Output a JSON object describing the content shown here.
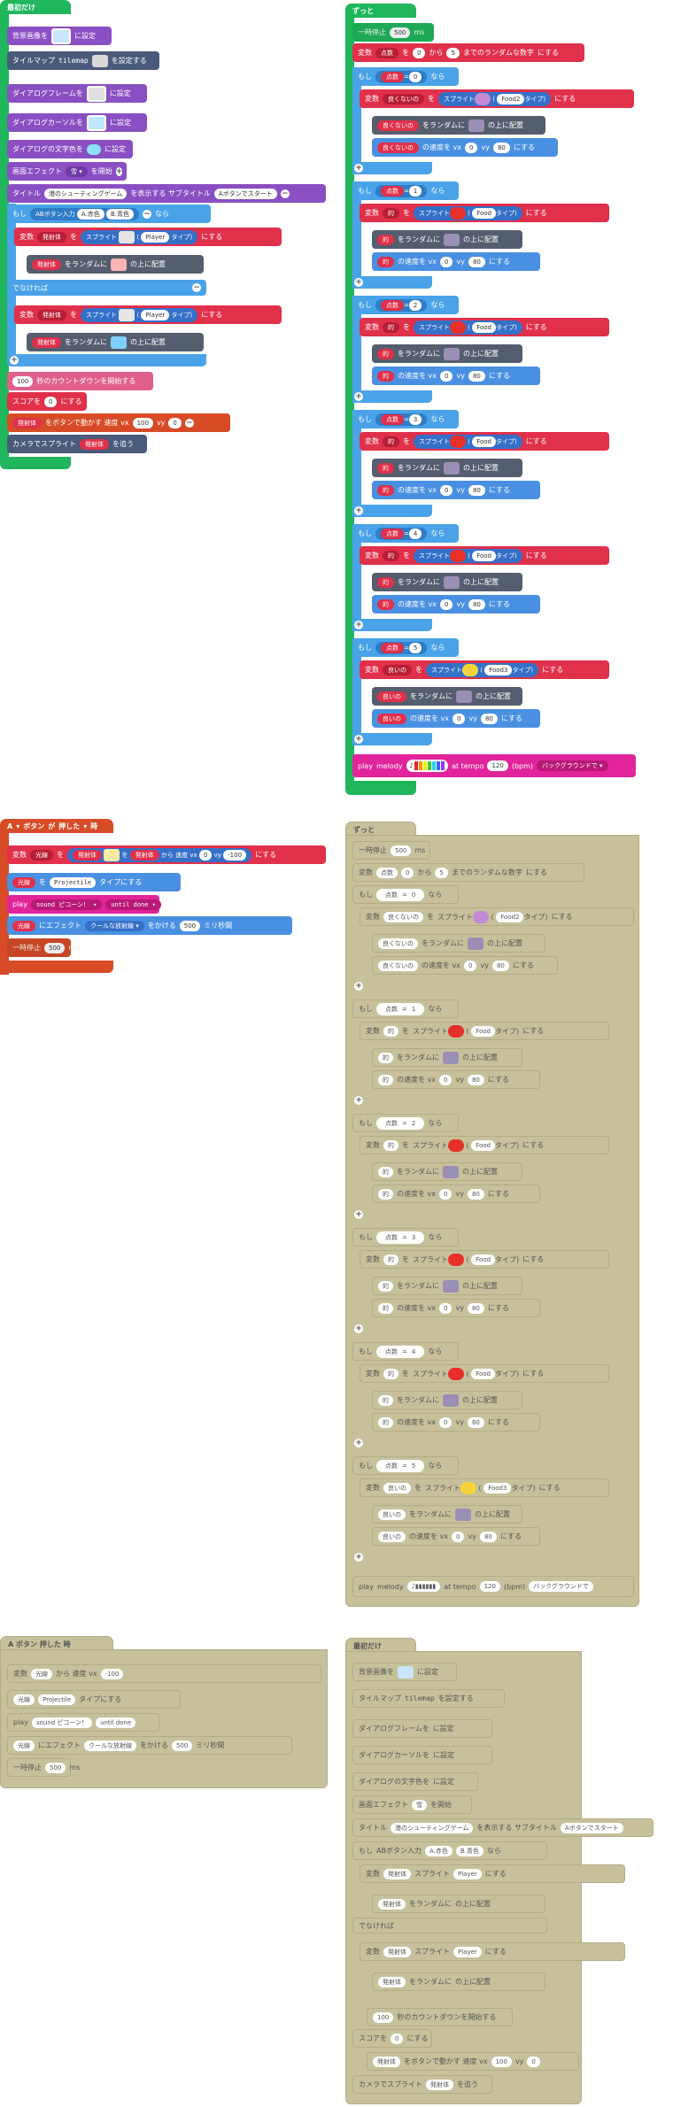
{
  "start_block": {
    "hat": "最初だけ",
    "bg": "背景画像を",
    "bg_set": "に設定",
    "tilemap": "タイルマップ",
    "tilemap_name": "tilemap",
    "tilemap_set": "を設定する",
    "dlg_frame": "ダイアログフレームを",
    "dlg_frame_set": "に設定",
    "dlg_cursor": "ダイアログカーソルを",
    "dlg_cursor_set": "に設定",
    "dlg_text": "ダイアログの文字色を",
    "dlg_text_set": "に設定",
    "effect": "画面エフェクト",
    "effect_val": "雪",
    "effect_start": "を開始",
    "title": "タイトル",
    "title_val": "港のシューティングゲーム",
    "title_show": "を表示する サブタイトル",
    "subtitle_val": "Aボタンでスタート",
    "if": "もし",
    "ab_input": "ABボタン入力",
    "a_red": "A.赤色",
    "b_red": "B.青色",
    "then": "なら",
    "var": "変数",
    "var_name": "発射体",
    "wo": "を",
    "sprite": "スプライト",
    "kind_player": "Player",
    "kind": "タイプ)",
    "set_to": "にする",
    "random": "をランダムに",
    "on_top": "の上に配置",
    "else": "でなければ",
    "countdown": "100",
    "countdown_text": "秒のカウントダウンを開始する",
    "score": "スコアを",
    "score_val": "0",
    "score_set": "にする",
    "move_btn": "をボタンで動かす 速度 vx",
    "vx": "100",
    "vy": "vy",
    "vy_val": "0",
    "camera": "カメラでスプライト",
    "camera_follow": "を追う"
  },
  "forever_block": {
    "hat": "ずっと",
    "pause": "一時停止",
    "pause_val": "500",
    "ms": "ms",
    "var": "変数",
    "score_var": "点数",
    "from": "から",
    "rand_from": "0",
    "rand_to": "5",
    "rand_text": "までのランダムな数字",
    "set_to": "にする",
    "if": "もし",
    "eq": "=",
    "then": "なら",
    "bad": "良くないの",
    "good": "良いの",
    "fruit": "的",
    "sprite": "スプライト",
    "kind_food2": "Food2",
    "kind_food": "Food",
    "kind_food3": "Food3",
    "kind": "タイプ)",
    "random": "をランダムに",
    "on_top": "の上に配置",
    "velocity": "の速度を vx",
    "vx_val": "0",
    "vy": "vy",
    "vy_val": "80",
    "cases": [
      "0",
      "1",
      "2",
      "3",
      "4",
      "5"
    ],
    "play": "play",
    "melody": "melody",
    "at_tempo": "at tempo",
    "tempo": "120",
    "bpm": "(bpm)",
    "background": "バックグラウンドで"
  },
  "a_button_block": {
    "hat_a": "A",
    "button": "ボタン",
    "pressed": "が",
    "pressed_val": "押した",
    "when": "時",
    "var": "変数",
    "projectile": "光線",
    "wo": "を",
    "from": "発射体",
    "from_text": "から 速度 vx",
    "vx_val": "0",
    "vy": "vy",
    "vy_val": "-100",
    "set_to": "にする",
    "kind_set": "を",
    "kind_projectile": "Projectile",
    "kind_set_text": "タイプにする",
    "play": "play",
    "sound": "sound ピコーン！",
    "until_done": "until done",
    "effect_text": "にエフェクト",
    "effect_val": "クールな放射線",
    "effect_apply": "をかける",
    "effect_ms": "500",
    "effect_unit": "ミリ秒間",
    "pause": "一時停止",
    "pause_val": "500",
    "ms": "ms"
  },
  "colors": {
    "event_green": "#1fb65c",
    "scene_purple": "#8a4fc3",
    "tilemap_slate": "#4a5a7a",
    "variable_red": "#e0304a",
    "sprite_blue": "#4a90e2",
    "logic_lightblue": "#4aa3e8",
    "music_pink": "#e1249a",
    "controller_orange": "#d74b27",
    "ghost_olive": "#c6c19b"
  }
}
